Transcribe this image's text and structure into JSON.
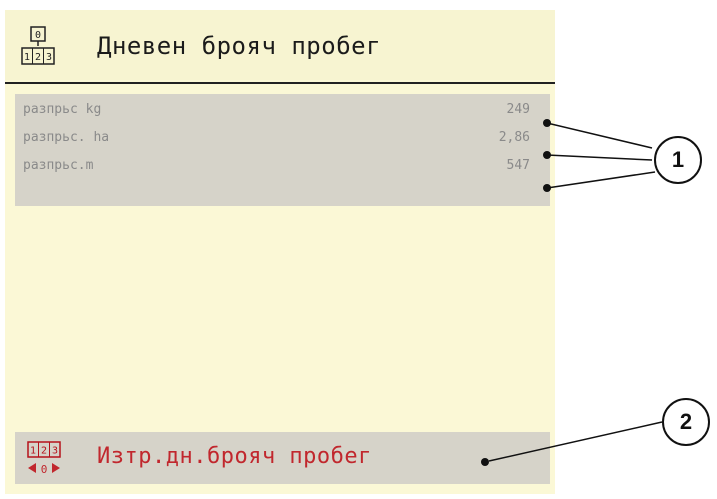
{
  "header": {
    "title": "Дневен брояч пробег",
    "icon": "counter-icon",
    "icon_top_digit": "0",
    "icon_digits": [
      "1",
      "2",
      "3"
    ]
  },
  "rows": [
    {
      "label": "разпрьс  kg",
      "value": "249"
    },
    {
      "label": "разпрьс. ha",
      "value": "2,86"
    },
    {
      "label": "разпрьс.m",
      "value": "547"
    }
  ],
  "reset": {
    "label": "Изтр.дн.брояч пробег",
    "icon": "reset-counter-icon",
    "icon_digits": [
      "1",
      "2",
      "3"
    ],
    "icon_bottom_digit": "0"
  },
  "callouts": {
    "values_marker": "1",
    "reset_marker": "2"
  },
  "colors": {
    "screen_bg": "#fbf8d6",
    "panel_bg": "#d6d3c9",
    "reset_text": "#c1272d",
    "value_text": "#8a8a8a"
  }
}
